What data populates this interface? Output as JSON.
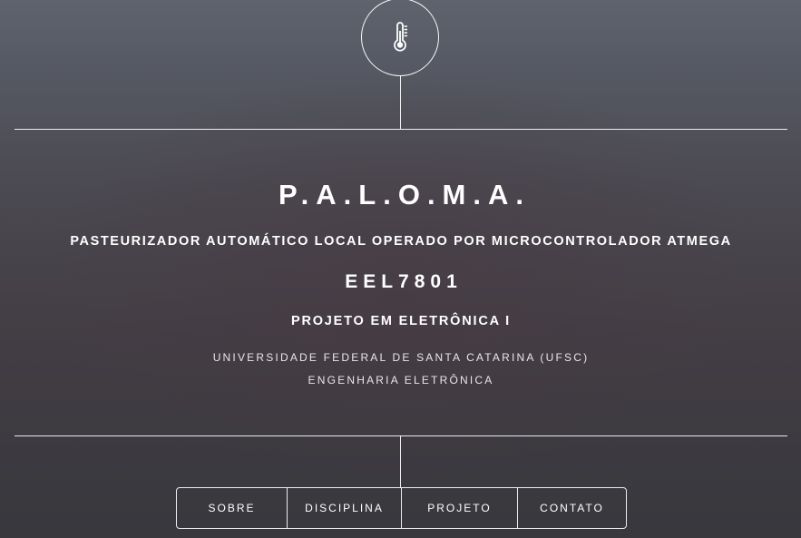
{
  "header": {
    "logo_icon": "thermometer-icon"
  },
  "main": {
    "title": "P.A.L.O.M.A.",
    "subtitle": "PASTEURIZADOR AUTOMÁTICO LOCAL OPERADO POR MICROCONTROLADOR ATMEGA",
    "code": "EEL7801",
    "course": "PROJETO EM ELETRÔNICA I",
    "institution": "UNIVERSIDADE FEDERAL DE SANTA CATARINA (UFSC)",
    "department": "ENGENHARIA ELETRÔNICA"
  },
  "nav": {
    "items": [
      {
        "label": "SOBRE"
      },
      {
        "label": "DISCIPLINA"
      },
      {
        "label": "PROJETO"
      },
      {
        "label": "CONTATO"
      }
    ]
  },
  "colors": {
    "text": "#ffffff",
    "background_top": "#5f636d",
    "background_bottom": "#38383d"
  }
}
